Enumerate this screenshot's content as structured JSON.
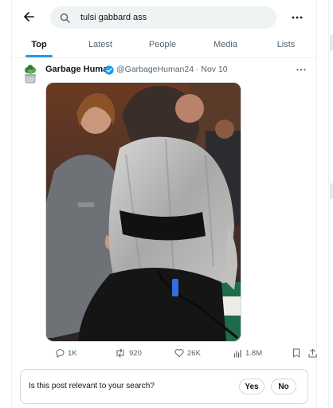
{
  "search": {
    "query": "tulsi gabbard ass"
  },
  "tabs": [
    {
      "label": "Top"
    },
    {
      "label": "Latest"
    },
    {
      "label": "People"
    },
    {
      "label": "Media"
    },
    {
      "label": "Lists"
    }
  ],
  "active_tab": "Top",
  "post": {
    "author": {
      "name": "Garbage Human",
      "handle_date": "@GarbageHuman24 · Nov 10"
    },
    "media": {
      "kind": "photo"
    },
    "metrics": {
      "replies": "1K",
      "reposts": "920",
      "likes": "26K",
      "views": "1.8M"
    }
  },
  "relevance_prompt": {
    "question": "Is this post relevant to your search?",
    "yes_label": "Yes",
    "no_label": "No"
  },
  "colors": {
    "accent": "#1d9bf0",
    "text_primary": "#0f1419",
    "text_secondary": "#536471",
    "search_bg": "#eff3f4",
    "border": "#cfd9de"
  },
  "icons": [
    "back-arrow-icon",
    "search-icon",
    "more-icon",
    "verified-badge-icon",
    "reply-icon",
    "repost-icon",
    "like-icon",
    "views-icon",
    "bookmark-icon",
    "share-icon"
  ]
}
